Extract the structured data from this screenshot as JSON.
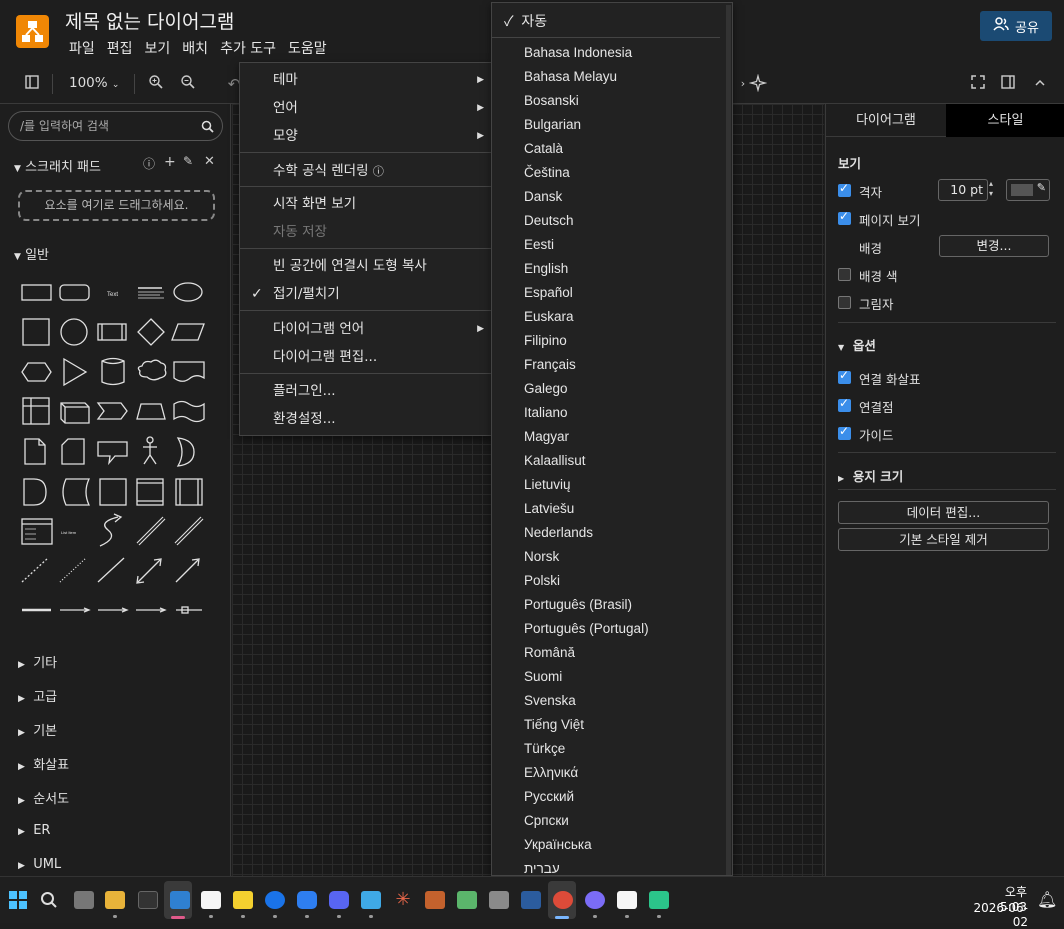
{
  "app": {
    "title": "제목 없는 다이어그램",
    "menu": [
      "파일",
      "편집",
      "보기",
      "배치",
      "추가 도구",
      "도움말"
    ],
    "share_label": "공유"
  },
  "toolbar": {
    "zoom": "100%"
  },
  "sidebar": {
    "search_placeholder": "/를 입력하여 검색",
    "scratchpad_title": "스크래치 패드",
    "dropzone_text": "요소를 여기로 드래그하세요.",
    "general_title": "일반",
    "sections": [
      "기타",
      "고급",
      "기본",
      "화살표",
      "순서도",
      "ER",
      "UML"
    ],
    "shape_text_label": "Text",
    "shape_list_label": "List Item"
  },
  "extras_menu": {
    "items": [
      {
        "label": "테마",
        "submenu": true
      },
      {
        "label": "언어",
        "submenu": true
      },
      {
        "label": "모양",
        "submenu": true
      },
      {
        "label": "수학 공식 렌더링",
        "help": true
      },
      {
        "label": "시작 화면 보기"
      },
      {
        "label": "자동 저장",
        "disabled": true
      },
      {
        "label": "빈 공간에 연결시 도형 복사"
      },
      {
        "label": "접기/펼치기",
        "checked": true
      },
      {
        "label": "다이어그램 언어",
        "submenu": true
      },
      {
        "label": "다이어그램 편집..."
      },
      {
        "label": "플러그인..."
      },
      {
        "label": "환경설정..."
      }
    ]
  },
  "language_menu": {
    "selected": "자동",
    "languages": [
      "Bahasa Indonesia",
      "Bahasa Melayu",
      "Bosanski",
      "Bulgarian",
      "Català",
      "Čeština",
      "Dansk",
      "Deutsch",
      "Eesti",
      "English",
      "Español",
      "Euskara",
      "Filipino",
      "Français",
      "Galego",
      "Italiano",
      "Magyar",
      "Kalaallisut",
      "Lietuvių",
      "Latviešu",
      "Nederlands",
      "Norsk",
      "Polski",
      "Português (Brasil)",
      "Português (Portugal)",
      "Română",
      "Suomi",
      "Svenska",
      "Tiếng Việt",
      "Türkçe",
      "Ελληνικά",
      "Русский",
      "Српски",
      "Українська",
      "עברית"
    ]
  },
  "right_panel": {
    "tab_diagram": "다이어그램",
    "tab_style": "스타일",
    "view_title": "보기",
    "grid_label": "격자",
    "grid_size": "10 pt",
    "page_view_label": "페이지 보기",
    "background_label": "배경",
    "change_button": "변경...",
    "background_color_label": "배경 색",
    "shadow_label": "그림자",
    "options_title": "옵션",
    "connection_arrows_label": "연결 화살표",
    "connection_points_label": "연결점",
    "guides_label": "가이드",
    "paper_size_title": "용지 크기",
    "edit_data_button": "데이터 편집...",
    "clear_default_style_button": "기본 스타일 제거",
    "checks": {
      "grid": true,
      "page_view": true,
      "bg_color": false,
      "shadow": false,
      "conn_arrows": true,
      "conn_points": true,
      "guides": true
    }
  },
  "taskbar": {
    "time": "오후 5:03",
    "date": "2026-06-02"
  }
}
